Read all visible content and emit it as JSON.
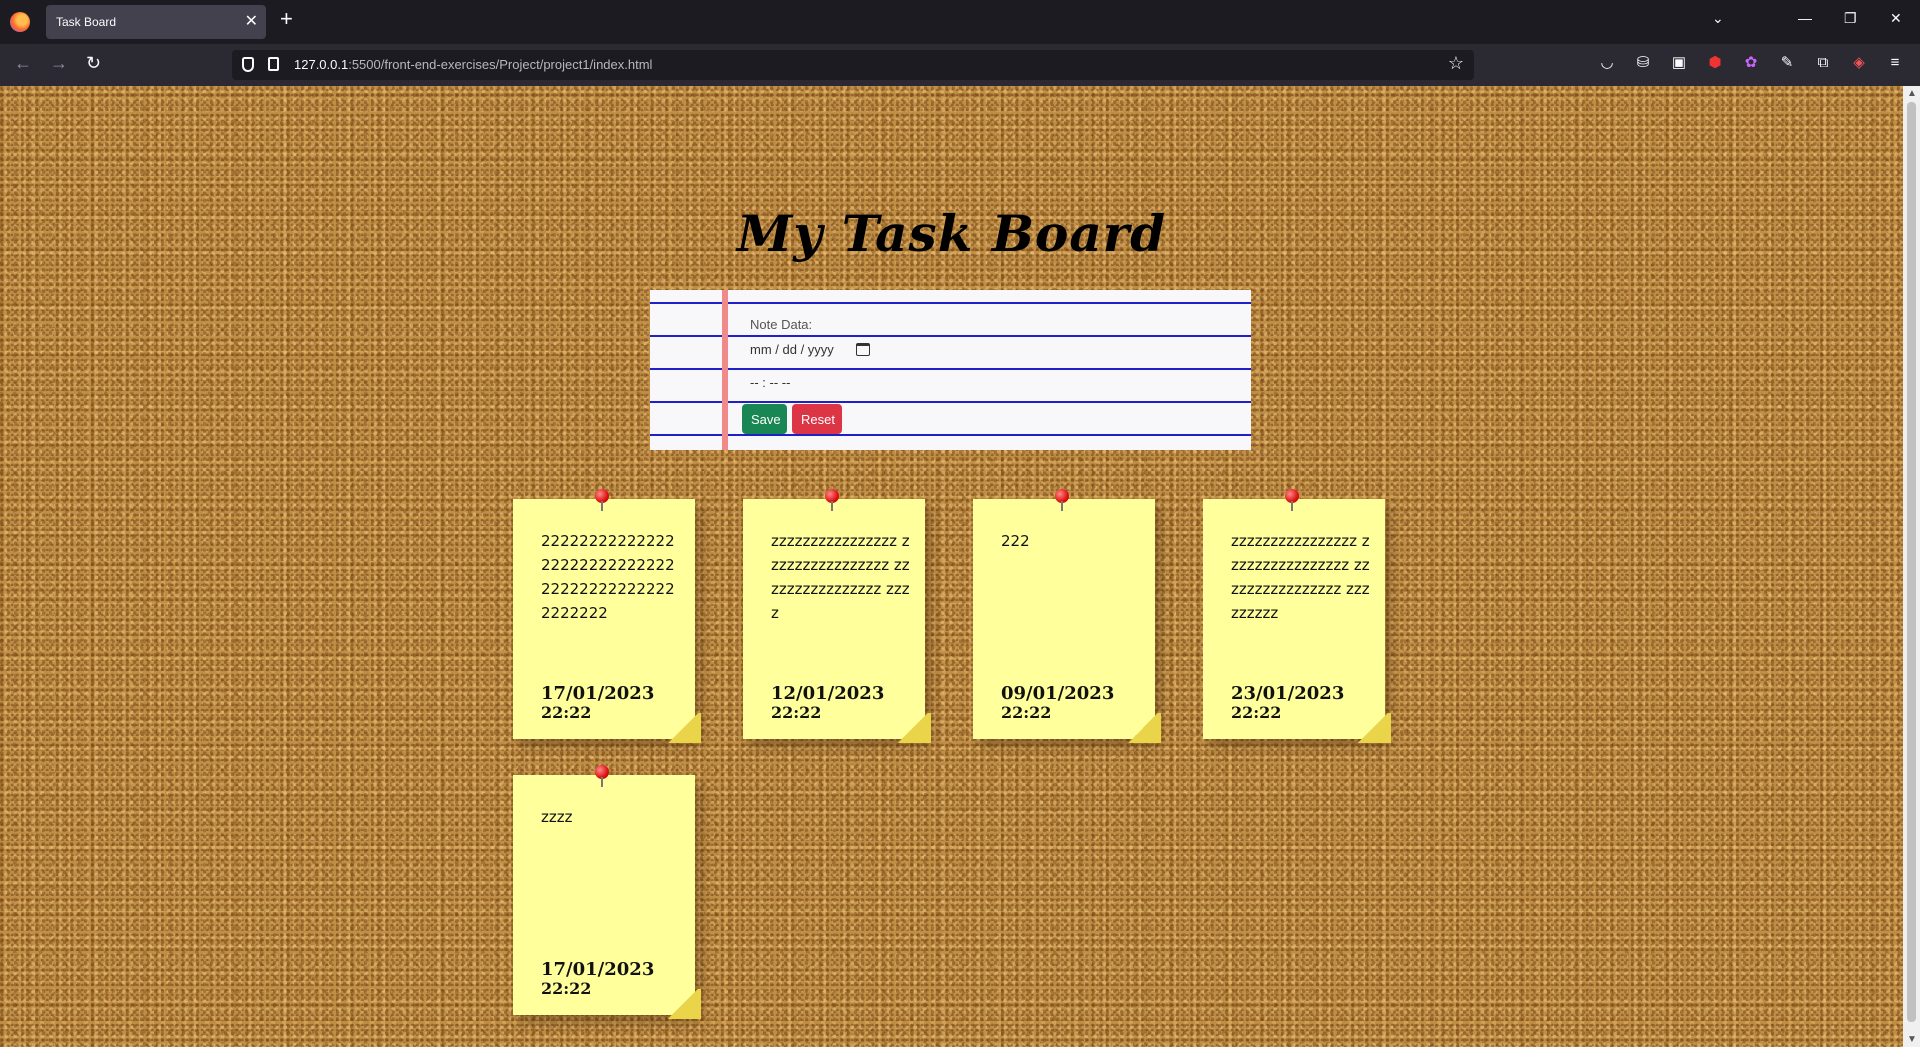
{
  "browser": {
    "tab_title": "Task Board",
    "tab_close": "✕",
    "new_tab": "+",
    "url_host": "127.0.0.1",
    "url_path": ":5500/front-end-exercises/Project/project1/index.html",
    "icons": [
      "pocket-icon",
      "extension-icon",
      "reader-icon",
      "adblock-icon",
      "color-icon",
      "pen-icon",
      "puzzle-icon",
      "shield-ext-icon",
      "menu-icon"
    ]
  },
  "page": {
    "title": "My Task Board"
  },
  "form": {
    "note_placeholder": "Note Data:",
    "date_placeholder": "mm / dd / yyyy",
    "time_placeholder": "-- : --  --",
    "save_label": "Save",
    "reset_label": "Reset"
  },
  "notes": [
    {
      "text": "22222222222222 22222222222222 22222222222222 2222222",
      "date": "17/01/2023",
      "time": "22:22"
    },
    {
      "text": "zzzzzzzzzzzzzzzz zzzzzzzzzzzzzzzz zzzzzzzzzzzzzzzz zzzz",
      "date": "12/01/2023",
      "time": "22:22"
    },
    {
      "text": "222",
      "date": "09/01/2023",
      "time": "22:22"
    },
    {
      "text": "zzzzzzzzzzzzzzzz zzzzzzzzzzzzzzzz zzzzzzzzzzzzzzzz zzzzzzzzz",
      "date": "23/01/2023",
      "time": "22:22"
    },
    {
      "text": "zzzz",
      "date": "17/01/2023",
      "time": "22:22"
    }
  ],
  "colors": {
    "note_bg": "#ffff9b",
    "save_btn": "#198754",
    "reset_btn": "#dc3545",
    "margin_line": "#f08a8a",
    "rule_line": "#2020c8"
  }
}
